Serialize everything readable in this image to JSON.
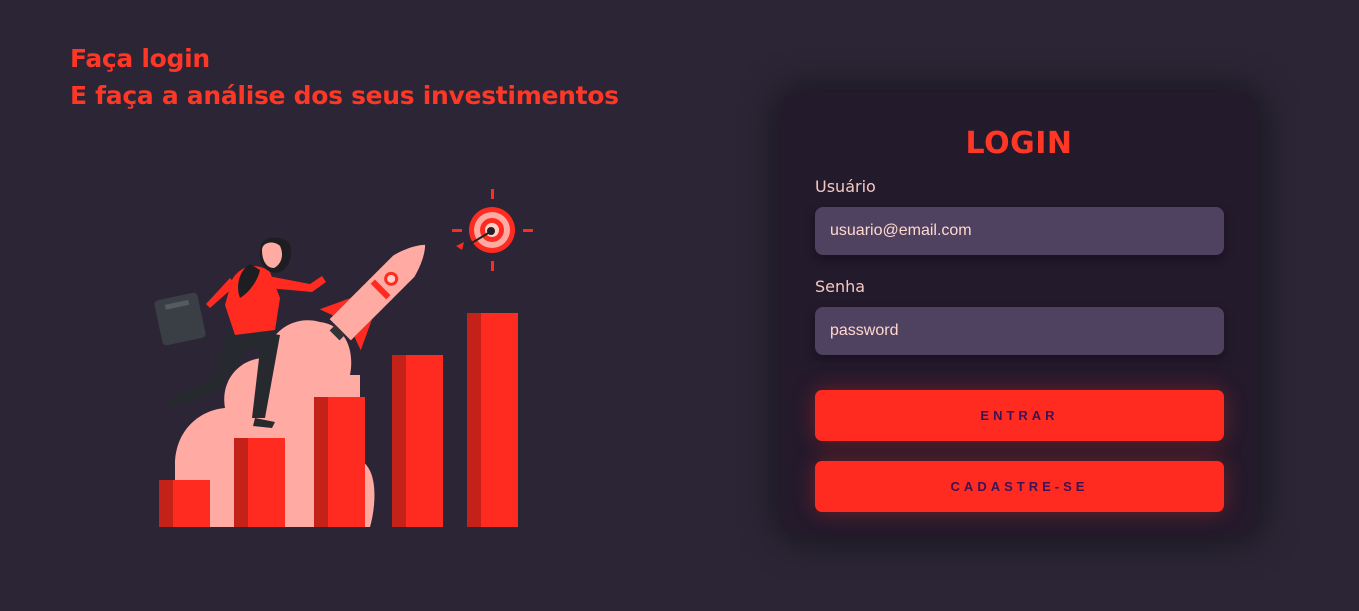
{
  "headline": {
    "line1": "Faça login",
    "line2": "E faça a análise dos seus investimentos"
  },
  "login_card": {
    "title": "LOGIN",
    "username_label": "Usuário",
    "username_placeholder": "usuario@email.com",
    "password_label": "Senha",
    "password_placeholder": "password",
    "enter_button": "ENTRAR",
    "signup_button": "CADASTRE-SE"
  },
  "colors": {
    "background": "#2b2535",
    "card": "#231a2c",
    "accent": "#ff2b20",
    "input": "#4f4260",
    "button_text": "#3a1457"
  },
  "icons": {
    "illustration": "rocket-growth-illustration",
    "target": "target-icon",
    "rocket": "rocket-icon"
  }
}
